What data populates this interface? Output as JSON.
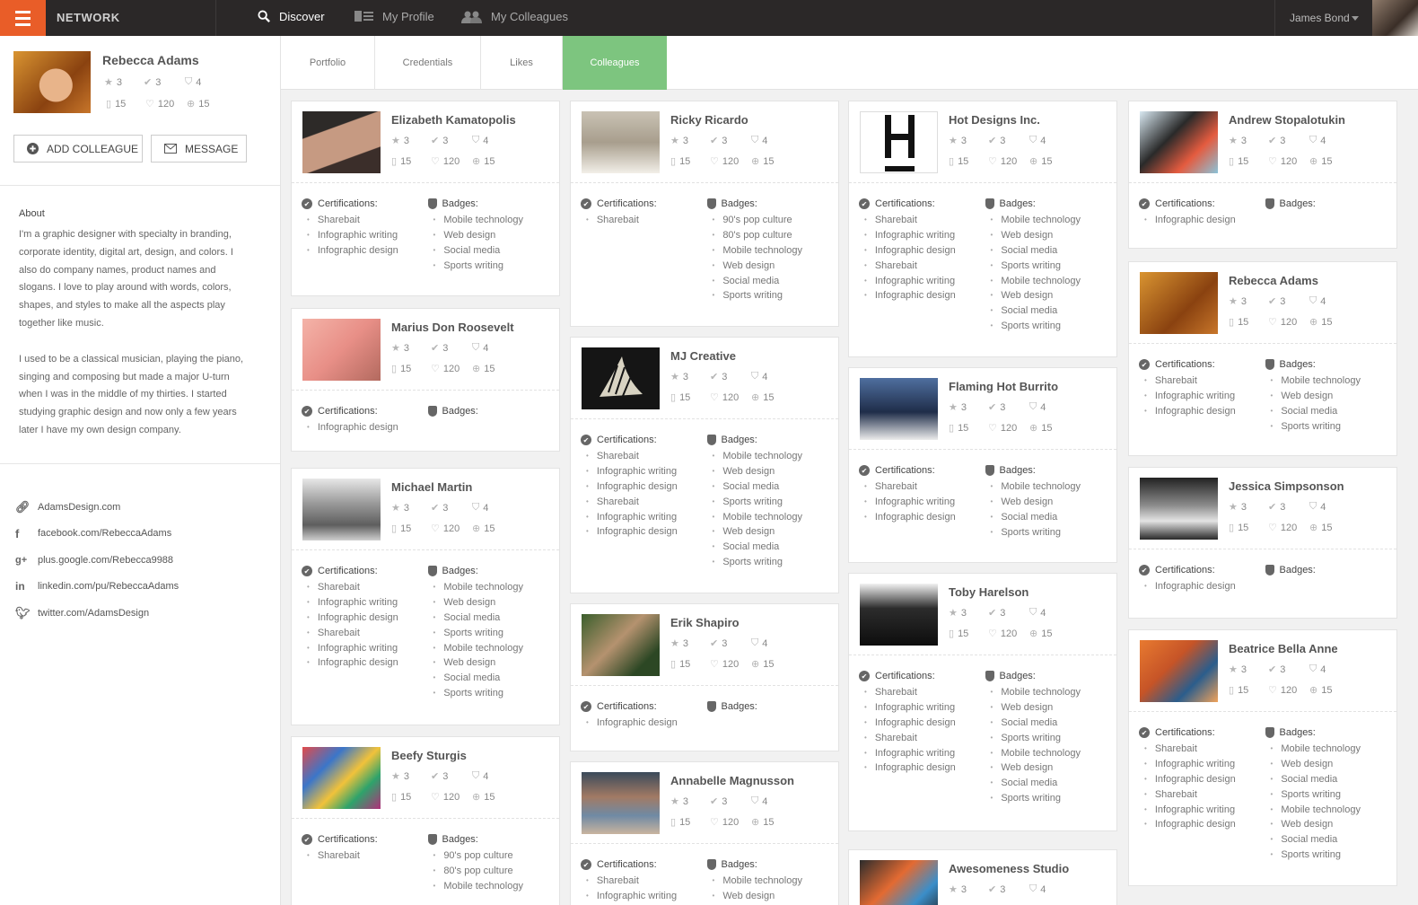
{
  "topbar": {
    "brand": "NETWORK",
    "nav": [
      {
        "label": "Discover",
        "icon": "search-icon"
      },
      {
        "label": "My Profile",
        "icon": "profile-card-icon"
      },
      {
        "label": "My Colleagues",
        "icon": "group-icon"
      }
    ],
    "user": "James Bond",
    "accent": "#e95d28"
  },
  "profile": {
    "name": "Rebecca Adams",
    "stats": {
      "stars": "3",
      "checks": "3",
      "badges": "4",
      "docs": "15",
      "likes": "120",
      "plus": "15"
    },
    "add_colleague": "ADD COLLEAGUE",
    "message": "MESSAGE",
    "about_title": "About",
    "about_p1": "I'm a graphic designer with specialty in branding, corporate identity, digital art, design, and colors. I also do company names, product names and slogans. I love to play around with words, colors, shapes, and styles to make all the aspects play together like music.",
    "about_p2": "I used to be a classical musician, playing the piano, singing and composing but made a major U-turn when I was in the middle of my thirties. I started studying graphic design and now only a few years later I have my own design company.",
    "links": [
      {
        "icon": "link-icon",
        "text": "AdamsDesign.com"
      },
      {
        "icon": "facebook-icon",
        "text": "facebook.com/RebeccaAdams"
      },
      {
        "icon": "google-plus-icon",
        "text": "plus.google.com/Rebecca9988"
      },
      {
        "icon": "linkedin-icon",
        "text": "linkedin.com/pu/RebeccaAdams"
      },
      {
        "icon": "twitter-icon",
        "text": "twitter.com/AdamsDesign"
      }
    ]
  },
  "tabs": [
    {
      "label": "Portfolio"
    },
    {
      "label": "Credentials"
    },
    {
      "label": "Likes"
    },
    {
      "label": "Colleagues",
      "active": true
    }
  ],
  "labels": {
    "certifications": "Certifications:",
    "badges": "Badges:"
  },
  "stats": {
    "stars": "3",
    "checks": "3",
    "badges": "4",
    "docs": "15",
    "likes": "120",
    "plus": "15"
  },
  "columns": [
    [
      {
        "name": "Elizabeth Kamatopolis",
        "certs": [
          "Sharebait",
          "Infographic writing",
          "Infographic design"
        ],
        "badges": [
          "Mobile technology",
          "Web design",
          "Social media",
          "Sports writing"
        ]
      },
      {
        "name": "Marius Don Roosevelt",
        "certs": [
          "Infographic design"
        ],
        "badges": []
      },
      {
        "name": "Michael Martin",
        "certs": [
          "Sharebait",
          "Infographic writing",
          "Infographic design",
          "Sharebait",
          "Infographic writing",
          "Infographic design"
        ],
        "badges": [
          "Mobile technology",
          "Web design",
          "Social media",
          "Sports writing",
          "Mobile technology",
          "Web design",
          "Social media",
          "Sports writing"
        ]
      },
      {
        "name": "Beefy Sturgis",
        "certs": [
          "Sharebait"
        ],
        "badges": [
          "90's pop culture",
          "80's pop culture",
          "Mobile technology"
        ]
      }
    ],
    [
      {
        "name": "Ricky Ricardo",
        "certs": [
          "Sharebait"
        ],
        "badges": [
          "90's pop culture",
          "80's pop culture",
          "Mobile technology",
          "Web design",
          "Social media",
          "Sports writing"
        ]
      },
      {
        "name": "MJ Creative",
        "certs": [
          "Sharebait",
          "Infographic writing",
          "Infographic design",
          "Sharebait",
          "Infographic writing",
          "Infographic design"
        ],
        "badges": [
          "Mobile technology",
          "Web design",
          "Social media",
          "Sports writing",
          "Mobile technology",
          "Web design",
          "Social media",
          "Sports writing"
        ]
      },
      {
        "name": "Erik Shapiro",
        "certs": [
          "Infographic design"
        ],
        "badges": []
      },
      {
        "name": "Annabelle Magnusson",
        "certs": [
          "Sharebait",
          "Infographic writing"
        ],
        "badges": [
          "Mobile technology",
          "Web design"
        ]
      }
    ],
    [
      {
        "name": "Hot Designs Inc.",
        "certs": [
          "Sharebait",
          "Infographic writing",
          "Infographic design",
          "Sharebait",
          "Infographic writing",
          "Infographic design"
        ],
        "badges": [
          "Mobile technology",
          "Web design",
          "Social media",
          "Sports writing",
          "Mobile technology",
          "Web design",
          "Social media",
          "Sports writing"
        ]
      },
      {
        "name": "Flaming Hot Burrito",
        "certs": [
          "Sharebait",
          "Infographic writing",
          "Infographic design"
        ],
        "badges": [
          "Mobile technology",
          "Web design",
          "Social media",
          "Sports writing"
        ]
      },
      {
        "name": "Toby Harelson",
        "certs": [
          "Sharebait",
          "Infographic writing",
          "Infographic design",
          "Sharebait",
          "Infographic writing",
          "Infographic design"
        ],
        "badges": [
          "Mobile technology",
          "Web design",
          "Social media",
          "Sports writing",
          "Mobile technology",
          "Web design",
          "Social media",
          "Sports writing"
        ]
      },
      {
        "name": "Awesomeness Studio",
        "certs": [],
        "badges": []
      }
    ],
    [
      {
        "name": "Andrew Stopalotukin",
        "certs": [
          "Infographic design"
        ],
        "badges": []
      },
      {
        "name": "Rebecca Adams",
        "certs": [
          "Sharebait",
          "Infographic writing",
          "Infographic design"
        ],
        "badges": [
          "Mobile technology",
          "Web design",
          "Social media",
          "Sports writing"
        ]
      },
      {
        "name": "Jessica Simpsonson",
        "certs": [
          "Infographic design"
        ],
        "badges": []
      },
      {
        "name": "Beatrice Bella Anne",
        "certs": [
          "Sharebait",
          "Infographic writing",
          "Infographic design",
          "Sharebait",
          "Infographic writing",
          "Infographic design"
        ],
        "badges": [
          "Mobile technology",
          "Web design",
          "Social media",
          "Sports writing",
          "Mobile technology",
          "Web design",
          "Social media",
          "Sports writing"
        ]
      }
    ]
  ]
}
